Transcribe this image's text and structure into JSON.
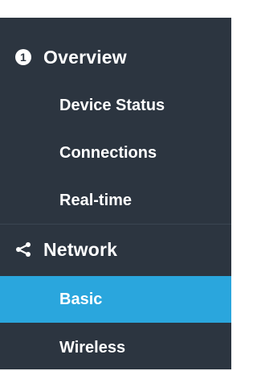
{
  "sidebar": {
    "accent_color": "#2aa6dd",
    "background_color": "#2c3540",
    "sections": [
      {
        "label": "Overview",
        "icon": "info-icon",
        "items": [
          {
            "label": "Device Status",
            "active": false
          },
          {
            "label": "Connections",
            "active": false
          },
          {
            "label": "Real-time",
            "active": false
          }
        ]
      },
      {
        "label": "Network",
        "icon": "share-icon",
        "items": [
          {
            "label": "Basic",
            "active": true
          },
          {
            "label": "Wireless",
            "active": false
          }
        ]
      }
    ]
  }
}
